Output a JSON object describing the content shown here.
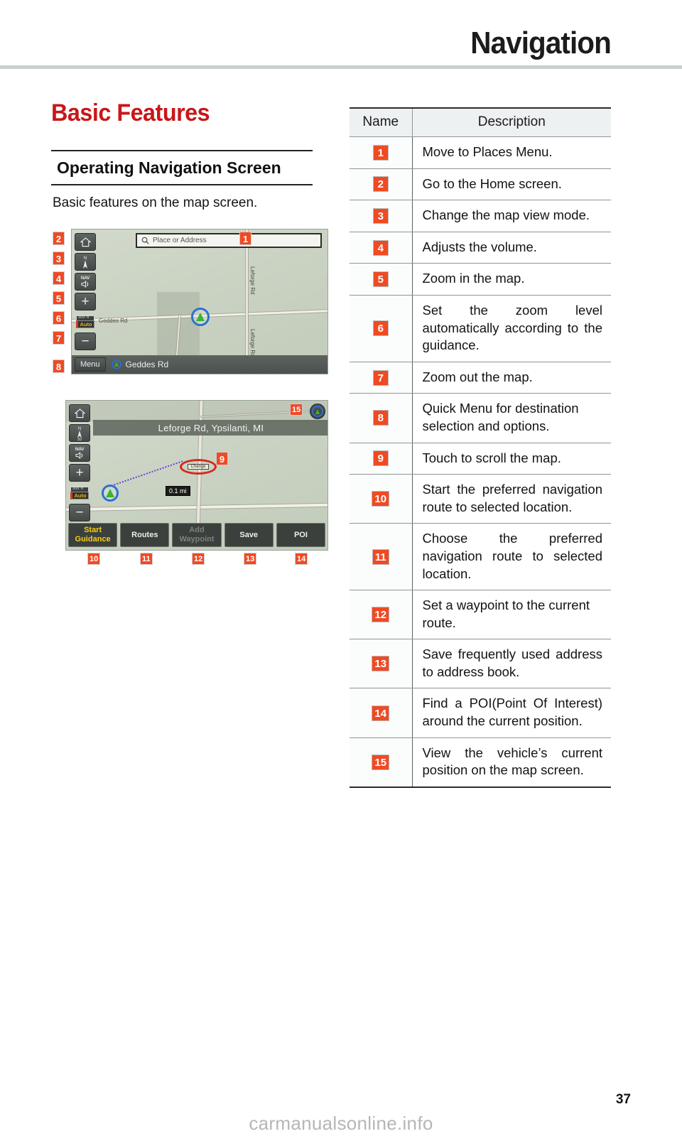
{
  "header": {
    "title": "Navigation"
  },
  "left": {
    "chapter_title": "Basic Features",
    "section_title": "Operating Navigation Screen",
    "lead_text": "Basic features on the map screen."
  },
  "map1": {
    "search_placeholder": "Place or Address",
    "search_icon": "magnifier-icon",
    "buttons": {
      "home": "home-icon",
      "compass": "N",
      "nav_volume_label": "NAV",
      "zoom_in": "+",
      "zoom_out": "−",
      "scale_value": "300 ft",
      "auto_label": "Auto"
    },
    "menu_label": "Menu",
    "current_road": "Geddes Rd",
    "road_labels": [
      "Geddes Rd",
      "Leforge Rd",
      "Leforge Rd"
    ],
    "callouts": [
      "1",
      "2",
      "3",
      "4",
      "5",
      "6",
      "7",
      "8"
    ]
  },
  "map2": {
    "title_strip": "Leforge Rd, Ypsilanti, MI",
    "dest_label": "Change",
    "distance_label": "0.1 mi",
    "buttons": {
      "home": "home-icon",
      "compass": "N",
      "compass_mode": "3D",
      "nav_volume_label": "NAV",
      "zoom_in": "+",
      "zoom_out": "−",
      "scale_value": "300 ft",
      "auto_label": "Auto"
    },
    "bottom_buttons": [
      {
        "label": "Start\nGuidance",
        "line1": "Start",
        "line2": "Guidance",
        "state": "accent"
      },
      {
        "label": "Routes",
        "line1": "Routes",
        "line2": "",
        "state": "normal"
      },
      {
        "label": "Add Waypoint",
        "line1": "Add",
        "line2": "Waypoint",
        "state": "disabled"
      },
      {
        "label": "Save",
        "line1": "Save",
        "line2": "",
        "state": "normal"
      },
      {
        "label": "POI",
        "line1": "POI",
        "line2": "",
        "state": "normal"
      }
    ],
    "callouts": [
      "9",
      "10",
      "11",
      "12",
      "13",
      "14",
      "15"
    ]
  },
  "table": {
    "columns": [
      "Name",
      "Description"
    ],
    "rows": [
      {
        "name": "1",
        "description": "Move to Places Menu."
      },
      {
        "name": "2",
        "description": "Go to the Home screen."
      },
      {
        "name": "3",
        "description": "Change the map view mode."
      },
      {
        "name": "4",
        "description": "Adjusts the volume."
      },
      {
        "name": "5",
        "description": "Zoom in the map."
      },
      {
        "name": "6",
        "description": "Set the zoom level automatically according to the guidance."
      },
      {
        "name": "7",
        "description": "Zoom out the map."
      },
      {
        "name": "8",
        "description": "Quick Menu for destination selection and options."
      },
      {
        "name": "9",
        "description": "Touch to scroll the map."
      },
      {
        "name": "10",
        "description": "Start the preferred navigation route to selected location."
      },
      {
        "name": "11",
        "description": "Choose the preferred navigation route to selected location."
      },
      {
        "name": "12",
        "description": "Set a waypoint to the current route."
      },
      {
        "name": "13",
        "description": "Save frequently used address to address book."
      },
      {
        "name": "14",
        "description": "Find a POI(Point Of Interest) around the current position."
      },
      {
        "name": "15",
        "description": "View the vehicle’s current position on the map screen."
      }
    ]
  },
  "footer": {
    "page_number": "37",
    "watermark": "carmanualsonline.info"
  },
  "colors": {
    "accent_red": "#c8171a",
    "callout_orange": "#f04a23",
    "header_rule": "#c9d2cd"
  }
}
